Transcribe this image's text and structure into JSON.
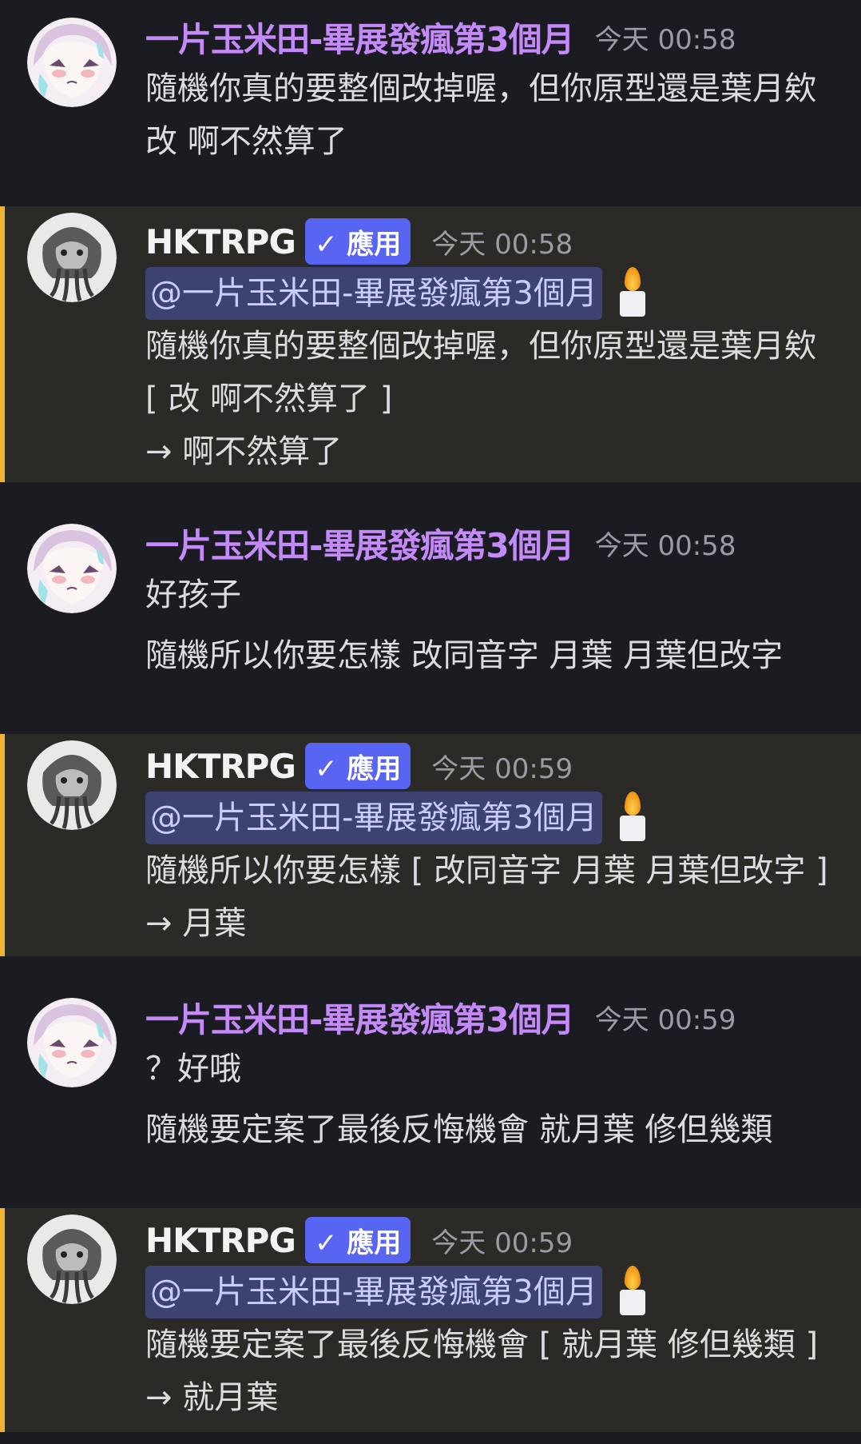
{
  "colors": {
    "background": "#1b1c22",
    "mention_background": "#2c2a27",
    "mention_bar": "#f0b232",
    "user_name": "#c58af9",
    "bot_name": "#f2f3f5",
    "badge": "#5865f2",
    "timestamp": "#9a9ca3",
    "mention_pill": "#3d4270"
  },
  "messages": [
    {
      "author": "一片玉米田-畢展發瘋第3個月",
      "timestamp": "今天 00:58",
      "avatar_icon": "anime-girl-avatar",
      "lines": [
        "隨機你真的要整個改掉喔，但你原型還是葉月欸",
        "改 啊不然算了"
      ]
    },
    {
      "author": "HKTRPG",
      "badge": "✓ 應用",
      "timestamp": "今天 00:58",
      "avatar_icon": "cthulhu-avatar",
      "mention": "@一片玉米田-畢展發瘋第3個月",
      "lines": [
        "隨機你真的要整個改掉喔，但你原型還是葉月欸",
        "[ 改 啊不然算了 ]",
        "→ 啊不然算了"
      ]
    },
    {
      "author": "一片玉米田-畢展發瘋第3個月",
      "timestamp": "今天 00:58",
      "avatar_icon": "anime-girl-avatar",
      "lines": [
        "好孩子",
        "隨機所以你要怎樣 改同音字 月葉 月葉但改字"
      ]
    },
    {
      "author": "HKTRPG",
      "badge": "✓ 應用",
      "timestamp": "今天 00:59",
      "avatar_icon": "cthulhu-avatar",
      "mention": "@一片玉米田-畢展發瘋第3個月",
      "lines": [
        "隨機所以你要怎樣 [ 改同音字 月葉 月葉但改字 ]",
        "→ 月葉"
      ]
    },
    {
      "author": "一片玉米田-畢展發瘋第3個月",
      "timestamp": "今天 00:59",
      "avatar_icon": "anime-girl-avatar",
      "lines": [
        "？好哦",
        "隨機要定案了最後反悔機會 就月葉 修但幾類"
      ]
    },
    {
      "author": "HKTRPG",
      "badge": "✓ 應用",
      "timestamp": "今天 00:59",
      "avatar_icon": "cthulhu-avatar",
      "mention": "@一片玉米田-畢展發瘋第3個月",
      "lines": [
        "隨機要定案了最後反悔機會 [ 就月葉 修但幾類 ]",
        "→ 就月葉"
      ]
    }
  ]
}
